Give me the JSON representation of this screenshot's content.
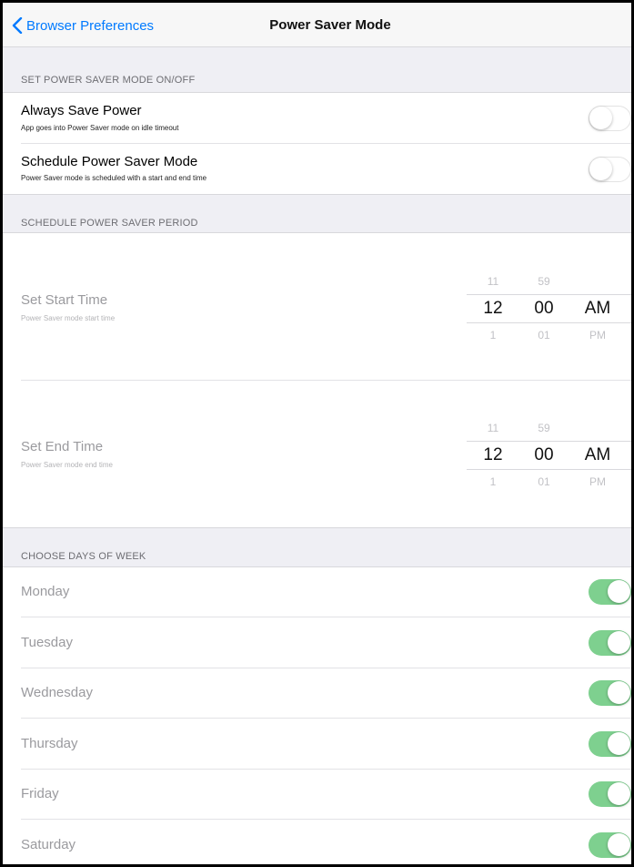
{
  "nav": {
    "back_label": "Browser Preferences",
    "title": "Power Saver Mode"
  },
  "sections": {
    "onoff": "SET POWER SAVER MODE ON/OFF",
    "period": "SCHEDULE POWER SAVER PERIOD",
    "days": "CHOOSE DAYS OF WEEK"
  },
  "always_save": {
    "label": "Always Save Power",
    "sublabel": "App goes into Power Saver mode on idle timeout",
    "enabled": false
  },
  "schedule_mode": {
    "label": "Schedule Power Saver Mode",
    "sublabel": "Power Saver mode is scheduled with a start and end time",
    "enabled": false
  },
  "start_time": {
    "label": "Set Start Time",
    "sublabel": "Power Saver mode start time",
    "hour_prev": "11",
    "hour": "12",
    "hour_next": "1",
    "minute_prev": "59",
    "minute": "00",
    "minute_next": "01",
    "period": "AM",
    "period_next": "PM"
  },
  "end_time": {
    "label": "Set End Time",
    "sublabel": "Power Saver mode end time",
    "hour_prev": "11",
    "hour": "12",
    "hour_next": "1",
    "minute_prev": "59",
    "minute": "00",
    "minute_next": "01",
    "period": "AM",
    "period_next": "PM"
  },
  "days": [
    {
      "label": "Monday",
      "enabled": true
    },
    {
      "label": "Tuesday",
      "enabled": true
    },
    {
      "label": "Wednesday",
      "enabled": true
    },
    {
      "label": "Thursday",
      "enabled": true
    },
    {
      "label": "Friday",
      "enabled": true
    },
    {
      "label": "Saturday",
      "enabled": true
    }
  ],
  "colors": {
    "accent": "#007aff",
    "toggle_on": "#7ed08f",
    "background": "#efeff4"
  }
}
